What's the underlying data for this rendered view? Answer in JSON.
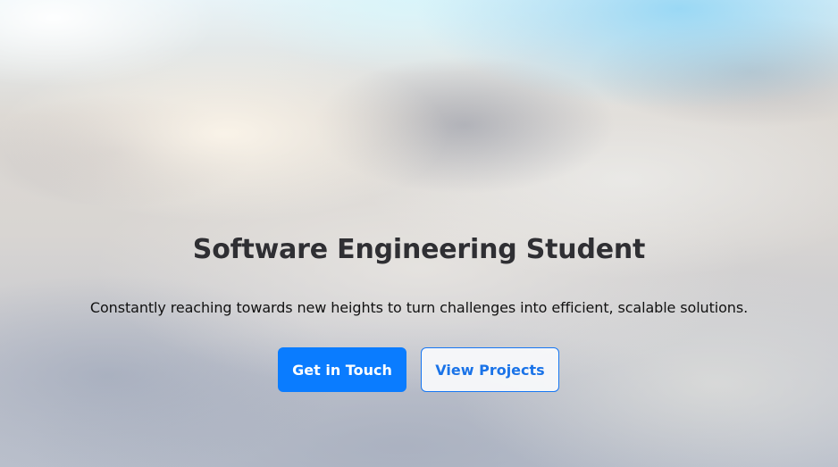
{
  "hero": {
    "title": "Software Engineering Student",
    "subtitle": "Constantly reaching towards new heights to turn challenges into efficient, scalable solutions.",
    "primary_button": "Get in Touch",
    "secondary_button": "View Projects"
  },
  "colors": {
    "primary": "#0a7cff",
    "secondary_text": "#1a73e8",
    "title": "#2f2f33"
  }
}
